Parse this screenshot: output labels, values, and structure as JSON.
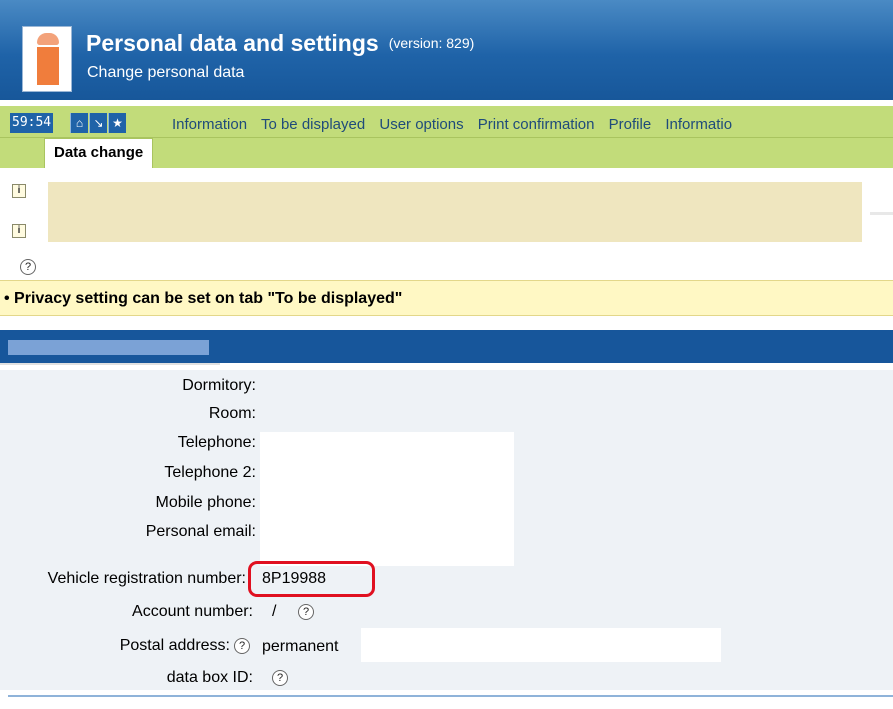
{
  "header": {
    "title": "Personal data and settings",
    "version": "(version: 829)",
    "subtitle": "Change personal data"
  },
  "menu": {
    "timer": "59:54",
    "items": [
      "Information",
      "To be displayed",
      "User options",
      "Print confirmation",
      "Profile",
      "Informatio"
    ]
  },
  "tabs": {
    "active": "Data change"
  },
  "notice": {
    "help_glyph": "?",
    "text": "• Privacy setting can be set on tab \"To be displayed\""
  },
  "form": {
    "fields": [
      {
        "label": "Dormitory:",
        "value": ""
      },
      {
        "label": "Room:",
        "value": ""
      },
      {
        "label": "Telephone:",
        "value": ""
      },
      {
        "label": "Telephone 2:",
        "value": ""
      },
      {
        "label": "Mobile phone:",
        "value": ""
      },
      {
        "label": "Personal email:",
        "value": ""
      },
      {
        "label": "Vehicle registration number:",
        "value": "8P19988"
      },
      {
        "label": "Account number:",
        "value": "/"
      },
      {
        "label": "Postal address:",
        "value": "permanent"
      },
      {
        "label": "data box ID:",
        "value": ""
      }
    ]
  },
  "colors": {
    "header_blue": "#1f63a8",
    "menu_green": "#c2dc7a",
    "notice_yellow": "#fff8c4",
    "highlight_red": "#e01020"
  }
}
